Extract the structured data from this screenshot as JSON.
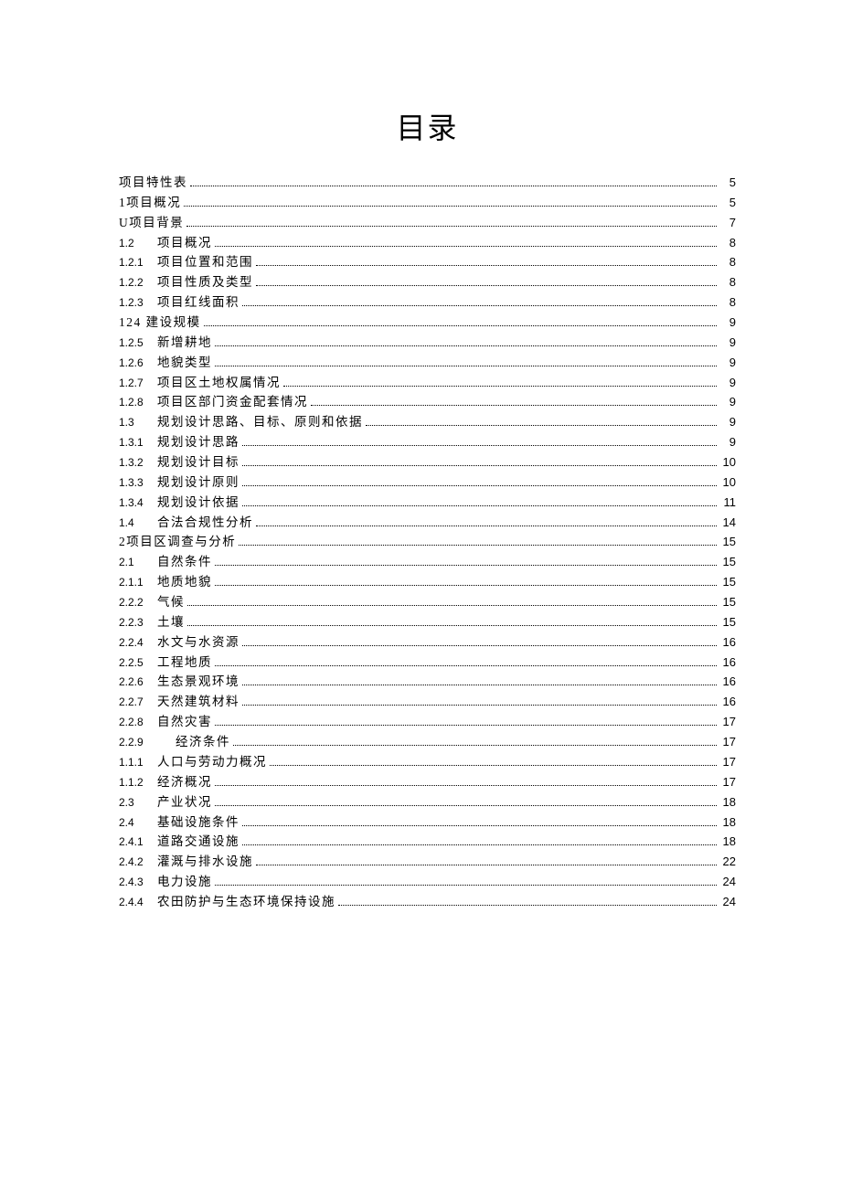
{
  "title": "目录",
  "entries": [
    {
      "num": "",
      "text": "项目特性表",
      "page": "5",
      "noNum": true
    },
    {
      "num": "",
      "text": "1项目概况",
      "page": "5",
      "noNum": true
    },
    {
      "num": "",
      "text": "U项目背景",
      "page": "7",
      "noNum": true
    },
    {
      "num": "1.2",
      "text": "项目概况",
      "page": "8"
    },
    {
      "num": "1.2.1",
      "text": "项目位置和范围",
      "page": "8"
    },
    {
      "num": "1.2.2",
      "text": "项目性质及类型",
      "page": "8"
    },
    {
      "num": "1.2.3",
      "text": "项目红线面积",
      "page": "8"
    },
    {
      "num": "",
      "text": "124 建设规模",
      "page": "9",
      "noNum": true
    },
    {
      "num": "1.2.5",
      "text": "新增耕地",
      "page": "9"
    },
    {
      "num": "1.2.6",
      "text": "地貌类型",
      "page": "9"
    },
    {
      "num": "1.2.7",
      "text": "项目区土地权属情况",
      "page": "9"
    },
    {
      "num": "1.2.8",
      "text": "项目区部门资金配套情况",
      "page": "9"
    },
    {
      "num": "1.3",
      "text": "规划设计思路、目标、原则和依据",
      "page": "9"
    },
    {
      "num": "1.3.1",
      "text": "规划设计思路",
      "page": "9"
    },
    {
      "num": "1.3.2",
      "text": "规划设计目标",
      "page": "10"
    },
    {
      "num": "1.3.3",
      "text": "规划设计原则",
      "page": "10"
    },
    {
      "num": "1.3.4",
      "text": "规划设计依据",
      "page": "11"
    },
    {
      "num": "1.4",
      "text": "合法合规性分析",
      "page": "14"
    },
    {
      "num": "",
      "text": "2项目区调查与分析",
      "page": "15",
      "noNum": true
    },
    {
      "num": "2.1",
      "text": "自然条件",
      "page": "15"
    },
    {
      "num": "2.1.1",
      "text": "地质地貌",
      "page": "15"
    },
    {
      "num": "2.2.2",
      "text": "气候",
      "page": "15"
    },
    {
      "num": "2.2.3",
      "text": "土壤",
      "page": "15"
    },
    {
      "num": "2.2.4",
      "text": "水文与水资源",
      "page": "16"
    },
    {
      "num": "2.2.5",
      "text": "工程地质",
      "page": "16"
    },
    {
      "num": "2.2.6",
      "text": "生态景观环境",
      "page": "16"
    },
    {
      "num": "2.2.7",
      "text": "天然建筑材料",
      "page": "16"
    },
    {
      "num": "2.2.8",
      "text": "自然灾害",
      "page": "17"
    },
    {
      "num": "2.2.9",
      "text": "经济条件",
      "page": "17",
      "indent": true
    },
    {
      "num": "1.1.1",
      "text": "人口与劳动力概况",
      "page": "17"
    },
    {
      "num": "1.1.2",
      "text": "经济概况",
      "page": "17"
    },
    {
      "num": "2.3",
      "text": "产业状况",
      "page": "18"
    },
    {
      "num": "2.4",
      "text": "基础设施条件",
      "page": "18"
    },
    {
      "num": "2.4.1",
      "text": "道路交通设施",
      "page": "18"
    },
    {
      "num": "2.4.2",
      "text": "灌溉与排水设施",
      "page": "22"
    },
    {
      "num": "2.4.3",
      "text": "电力设施",
      "page": "24"
    },
    {
      "num": "2.4.4",
      "text": "农田防护与生态环境保持设施",
      "page": "24"
    }
  ]
}
